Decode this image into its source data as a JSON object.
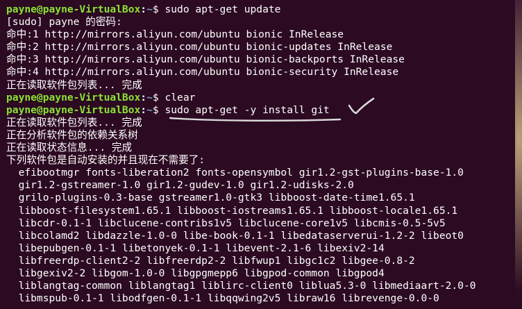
{
  "prompt": {
    "user_host": "payne@payne-VirtualBox",
    "separator": ":",
    "path": "~",
    "symbol": "$"
  },
  "terminal_lines": [
    {
      "type": "prompt",
      "command": "sudo apt-get update"
    },
    {
      "type": "output",
      "text": "[sudo] payne 的密码:"
    },
    {
      "type": "output",
      "text": "命中:1 http://mirrors.aliyun.com/ubuntu bionic InRelease"
    },
    {
      "type": "output",
      "text": "命中:2 http://mirrors.aliyun.com/ubuntu bionic-updates InRelease"
    },
    {
      "type": "output",
      "text": "命中:3 http://mirrors.aliyun.com/ubuntu bionic-backports InRelease"
    },
    {
      "type": "output",
      "text": "命中:4 http://mirrors.aliyun.com/ubuntu bionic-security InRelease"
    },
    {
      "type": "output",
      "text": "正在读取软件包列表... 完成"
    },
    {
      "type": "prompt",
      "command": "clear"
    },
    {
      "type": "prompt",
      "command": "sudo apt-get -y install git"
    },
    {
      "type": "output",
      "text": "正在读取软件包列表... 完成"
    },
    {
      "type": "output",
      "text": "正在分析软件包的依赖关系树"
    },
    {
      "type": "output",
      "text": "正在读取状态信息... 完成"
    },
    {
      "type": "output",
      "text": "下列软件包是自动安装的并且现在不需要了:"
    },
    {
      "type": "output",
      "text": "  efibootmgr fonts-liberation2 fonts-opensymbol gir1.2-gst-plugins-base-1.0"
    },
    {
      "type": "output",
      "text": "  gir1.2-gstreamer-1.0 gir1.2-gudev-1.0 gir1.2-udisks-2.0"
    },
    {
      "type": "output",
      "text": "  grilo-plugins-0.3-base gstreamer1.0-gtk3 libboost-date-time1.65.1"
    },
    {
      "type": "output",
      "text": "  libboost-filesystem1.65.1 libboost-iostreams1.65.1 libboost-locale1.65.1"
    },
    {
      "type": "output",
      "text": "  libcdr-0.1-1 libclucene-contribs1v5 libclucene-core1v5 libcmis-0.5-5v5"
    },
    {
      "type": "output",
      "text": "  libcolamd2 libdazzle-1.0-0 libe-book-0.1-1 libedataserverui-1.2-2 libeot0"
    },
    {
      "type": "output",
      "text": "  libepubgen-0.1-1 libetonyek-0.1-1 libevent-2.1-6 libexiv2-14"
    },
    {
      "type": "output",
      "text": "  libfreerdp-client2-2 libfreerdp2-2 libfwup1 libgc1c2 libgee-0.8-2"
    },
    {
      "type": "output",
      "text": "  libgexiv2-2 libgom-1.0-0 libgpgmepp6 libgpod-common libgpod4"
    },
    {
      "type": "output",
      "text": "  liblangtag-common liblangtag1 liblirc-client0 liblua5.3-0 libmediaart-2.0-0"
    },
    {
      "type": "output",
      "text": "  libmspub-0.1-1 libodfgen-0.1-1 libqqwing2v5 libraw16 librevenge-0.0-0"
    }
  ],
  "colors": {
    "background": "#2c0a22",
    "prompt_user": "#8ae234",
    "prompt_path": "#729fcf",
    "text": "#ffffff",
    "annotation": "#d8d8d8"
  }
}
